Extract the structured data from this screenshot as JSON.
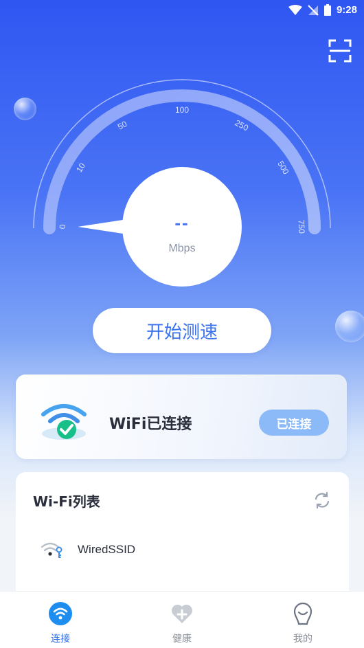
{
  "status_bar": {
    "time": "9:28"
  },
  "speedometer": {
    "value": "--",
    "unit": "Mbps",
    "ticks": [
      "0",
      "10",
      "50",
      "100",
      "250",
      "500",
      "750"
    ]
  },
  "start_button": {
    "label": "开始测速"
  },
  "wifi_status": {
    "text": "WiFi已连接",
    "badge": "已连接"
  },
  "wifi_list": {
    "title": "Wi-Fi列表",
    "items": [
      {
        "ssid": "WiredSSID"
      }
    ]
  },
  "bottom_nav": {
    "items": [
      {
        "label": "连接",
        "icon": "wifi-icon",
        "active": true
      },
      {
        "label": "健康",
        "icon": "heart-plus-icon",
        "active": false
      },
      {
        "label": "我的",
        "icon": "user-icon",
        "active": false
      }
    ]
  },
  "colors": {
    "accent": "#3b73ef",
    "active_nav": "#2a6fe8",
    "badge": "#8cbaf8"
  }
}
